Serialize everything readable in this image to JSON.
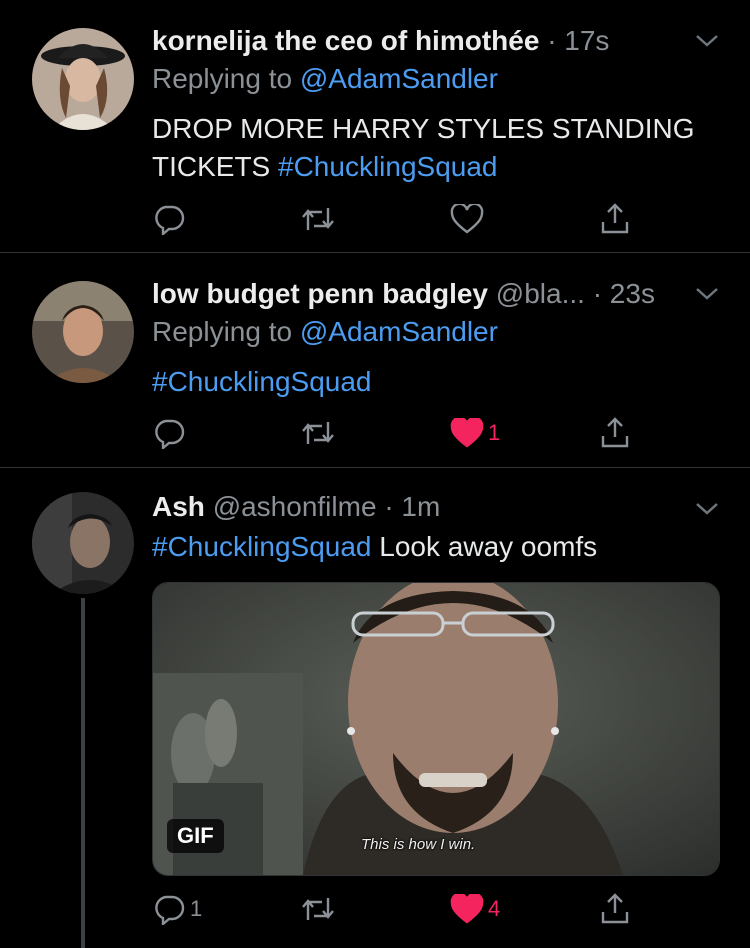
{
  "tweets": [
    {
      "name": "kornelija the ceo of himothée",
      "handle": "",
      "time": "· 17s",
      "replying_prefix": "Replying to ",
      "replying_to": "@AdamSandler",
      "text_line1": "DROP MORE HARRY STYLES STANDING",
      "text_line2": "TICKETS ",
      "hashtag": "#ChucklingSquad",
      "reply_count": "",
      "retweet_count": "",
      "like_count": ""
    },
    {
      "name": "low budget penn badgley",
      "handle": "@bla...",
      "time": "· 23s",
      "replying_prefix": "Replying to ",
      "replying_to": "@AdamSandler",
      "hashtag": "#ChucklingSquad",
      "reply_count": "",
      "retweet_count": "",
      "like_count": "1"
    },
    {
      "name": "Ash",
      "handle": "@ashonfilme",
      "time": "· 1m",
      "hashtag": "#ChucklingSquad",
      "text": " Look away oomfs",
      "media": {
        "badge": "GIF",
        "caption": "This is how I win."
      },
      "reply_count": "1",
      "retweet_count": "",
      "like_count": "4"
    }
  ],
  "colors": {
    "link": "#4c9df2",
    "liked": "#f4245e",
    "muted": "#8b9196",
    "background": "#000000"
  },
  "icons": [
    "reply-icon",
    "retweet-icon",
    "like-icon",
    "share-icon",
    "chevron-down-icon"
  ]
}
